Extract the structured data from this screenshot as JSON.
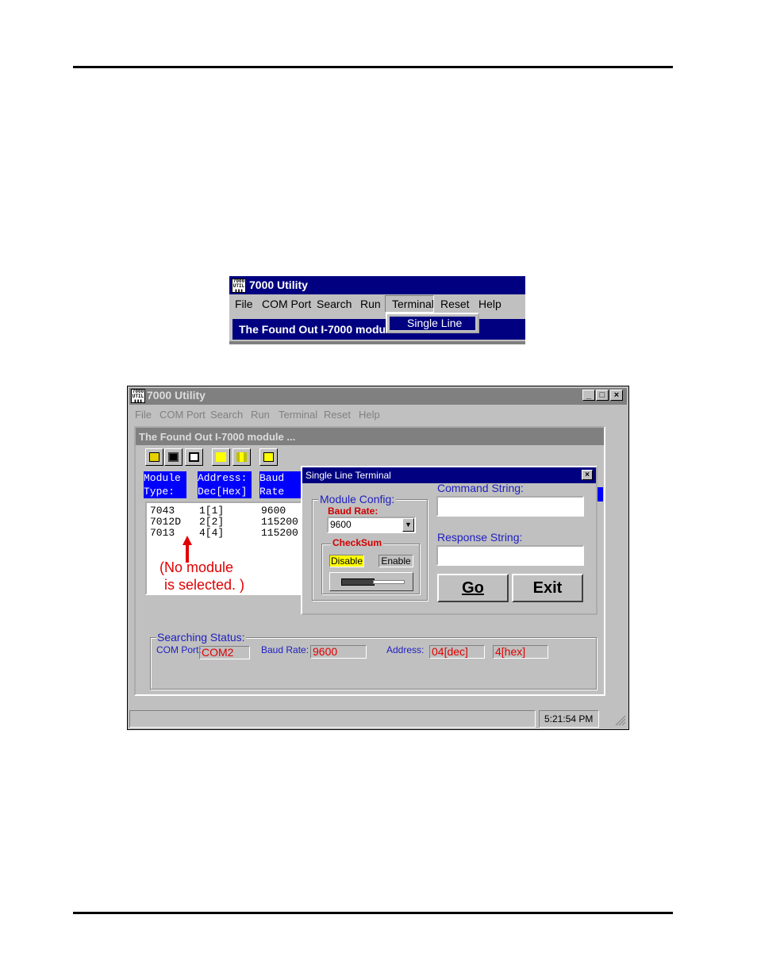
{
  "menu_shot": {
    "app_title": "7000 Utility",
    "menu": [
      "File",
      "COM Port",
      "Search",
      "Run",
      "Terminal",
      "Reset",
      "Help"
    ],
    "panel_title": "The Found Out I-7000 modu",
    "dropdown_item": "Single Line"
  },
  "window": {
    "app_title": "7000 Utility",
    "menu": [
      "File",
      "COM Port",
      "Search",
      "Run",
      "Terminal",
      "Reset",
      "Help"
    ],
    "panel_title": "The Found Out I-7000 module ...",
    "columns": [
      {
        "line1": "Module",
        "line2": "Type:"
      },
      {
        "line1": "Address:",
        "line2": "Dec[Hex]"
      },
      {
        "line1": "Baud",
        "line2": "Rate"
      }
    ],
    "rows": [
      {
        "type": "7043",
        "address": "1[1]",
        "baud": "9600"
      },
      {
        "type": "7012D",
        "address": "2[2]",
        "baud": "115200"
      },
      {
        "type": "7013",
        "address": "4[4]",
        "baud": "115200"
      }
    ],
    "annotation": {
      "line1": "(No module",
      "line2": "is selected. )"
    },
    "dialog": {
      "title": "Single Line Terminal",
      "module_config_label": "Module Config:",
      "baud_rate_label": "Baud Rate:",
      "baud_rate_value": "9600",
      "checksum_label": "CheckSum",
      "checksum_disable": "Disable",
      "checksum_enable": "Enable",
      "command_label": "Command String:",
      "command_value": "",
      "response_label": "Response String:",
      "response_value": "",
      "go_label": "Go",
      "exit_label": "Exit"
    },
    "status": {
      "group_label": "Searching Status:",
      "com_port_label": "COM Port:",
      "com_port_value": "COM2",
      "baud_rate_label": "Baud Rate:",
      "baud_rate_value": "9600",
      "address_label": "Address:",
      "address_dec": "04[dec]",
      "address_hex": "4[hex]"
    },
    "clock": "5:21:54 PM"
  },
  "colors": {
    "title_active": "#000080",
    "title_inactive": "#808080",
    "highlight": "#0000ff",
    "face": "#c0c0c0",
    "annotation": "#e00000"
  }
}
